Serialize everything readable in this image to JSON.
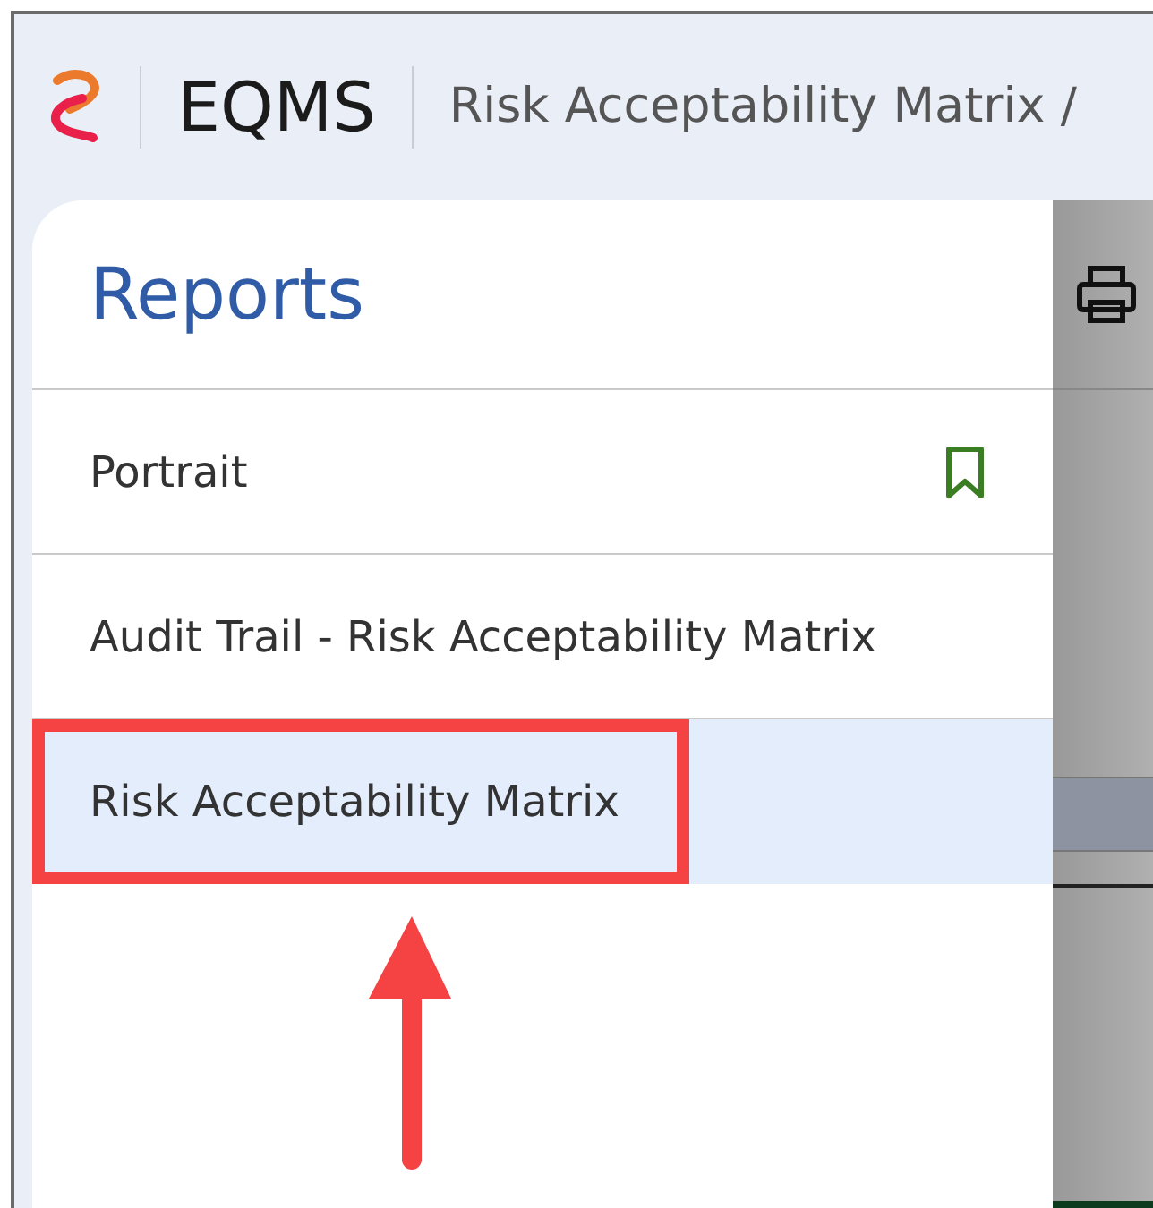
{
  "header": {
    "app_name": "EQMS",
    "breadcrumb": "Risk Acceptability Matrix /"
  },
  "panel": {
    "title": "Reports",
    "items": [
      {
        "label": "Portrait",
        "selected": false,
        "bookmarked": true,
        "highlighted": false
      },
      {
        "label": "Audit Trail - Risk Acceptability Matrix",
        "selected": false,
        "bookmarked": false,
        "highlighted": false
      },
      {
        "label": "Risk Acceptability Matrix",
        "selected": true,
        "bookmarked": false,
        "highlighted": true
      }
    ]
  }
}
